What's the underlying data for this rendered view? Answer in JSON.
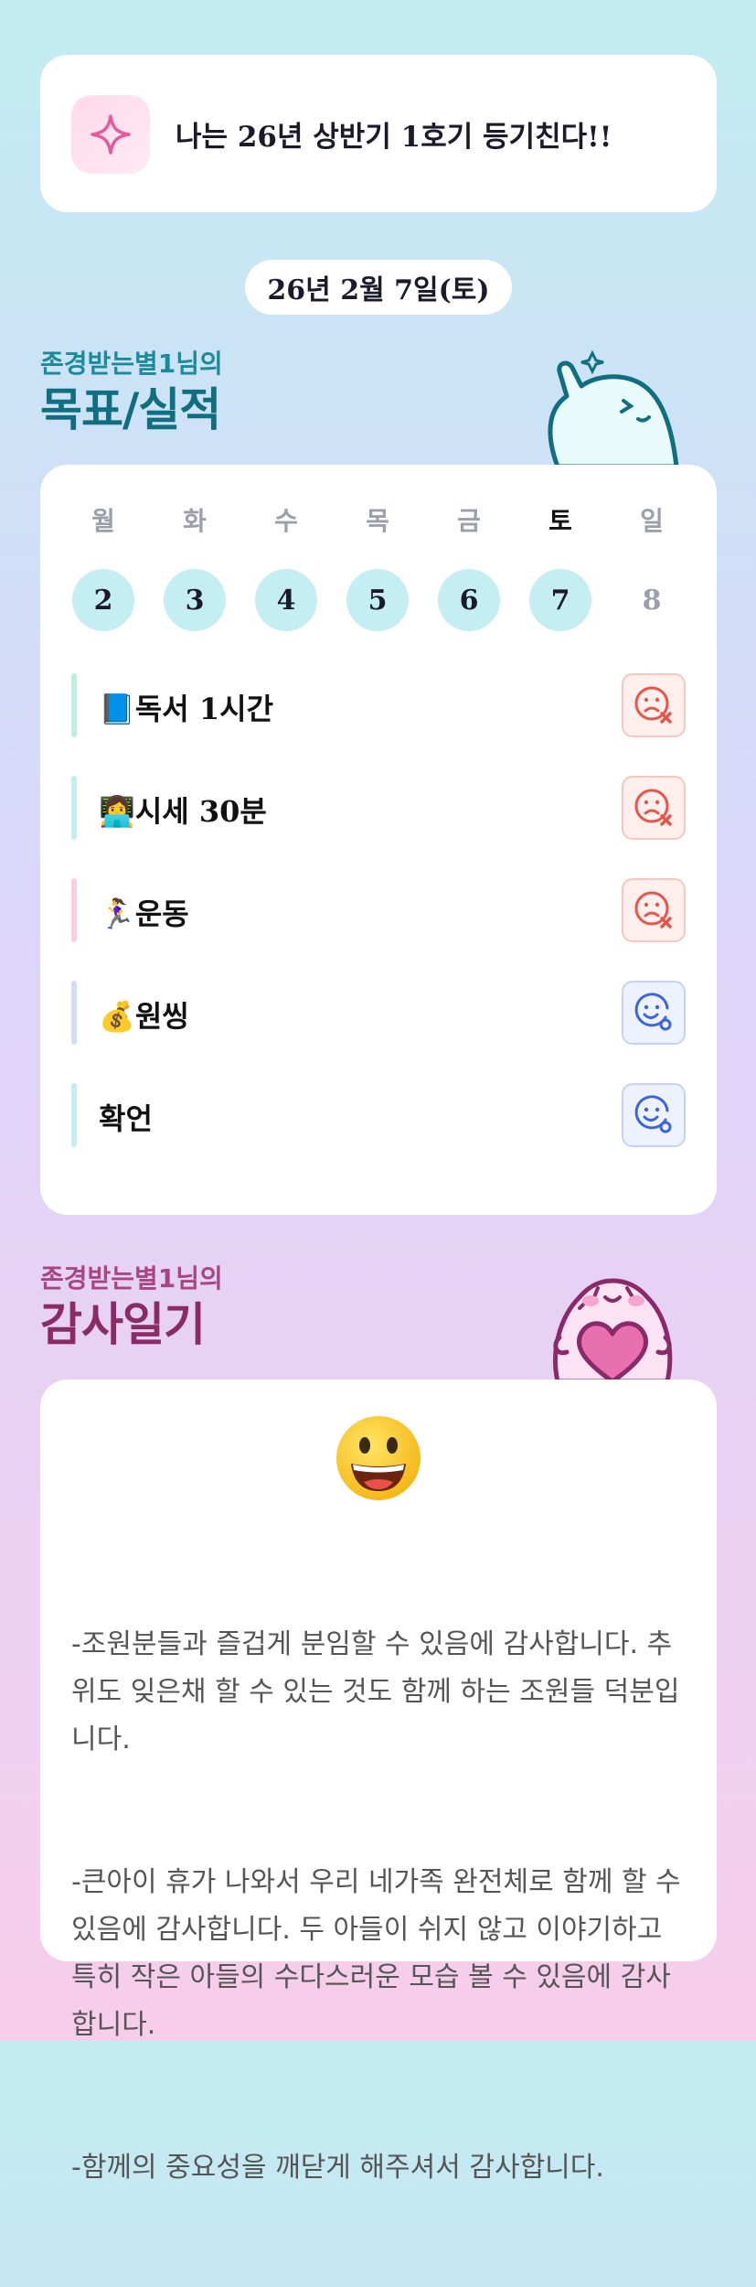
{
  "motto": {
    "text": "나는 26년 상반기 1호기 등기친다!!",
    "icon": "sparkle-icon"
  },
  "date": "26년 2월 7일(토)",
  "goals_section": {
    "subtitle": "존경받는별1님의",
    "title": "목표/실적"
  },
  "week": {
    "days": [
      {
        "label": "월",
        "num": "2",
        "today": false,
        "filled": true
      },
      {
        "label": "화",
        "num": "3",
        "today": false,
        "filled": true
      },
      {
        "label": "수",
        "num": "4",
        "today": false,
        "filled": true
      },
      {
        "label": "목",
        "num": "5",
        "today": false,
        "filled": true
      },
      {
        "label": "금",
        "num": "6",
        "today": false,
        "filled": true
      },
      {
        "label": "토",
        "num": "7",
        "today": true,
        "filled": true
      },
      {
        "label": "일",
        "num": "8",
        "today": false,
        "filled": false
      }
    ]
  },
  "goals": [
    {
      "label": "📘독서 1시간",
      "status": "fail",
      "bar_color": "#bfeee0"
    },
    {
      "label": "👩‍💻시세 30분",
      "status": "fail",
      "bar_color": "#c4eef2"
    },
    {
      "label": "🏃‍♀️운동",
      "status": "fail",
      "bar_color": "#f9cde2"
    },
    {
      "label": "💰원씽",
      "status": "ok",
      "bar_color": "#d7dcf6"
    },
    {
      "label": "확언",
      "status": "ok",
      "bar_color": "#c4eef2"
    }
  ],
  "gratitude_section": {
    "subtitle": "존경받는별1님의",
    "title": "감사일기"
  },
  "gratitude": {
    "emoji": "grinning-face-icon",
    "lines": [
      "-조원분들과 즐겁게 분임할 수 있음에 감사합니다. 추위도 잊은채 할 수 있는 것도 함께 하는 조원들 덕분입니다.",
      "-큰아이 휴가 나와서 우리 네가족 완전체로 함께 할 수 있음에 감사합니다. 두 아들이 쉬지 않고 이야기하고 특히 작은 아들의 수다스러운 모습 볼 수 있음에 감사합니다.",
      "-함께의 중요성을 깨닫게 해주셔서 감사합니다."
    ]
  },
  "colors": {
    "fail": "#e8544a",
    "ok": "#3a63e0",
    "accent_teal": "#0f6f80",
    "accent_pink": "#8a2a68"
  }
}
